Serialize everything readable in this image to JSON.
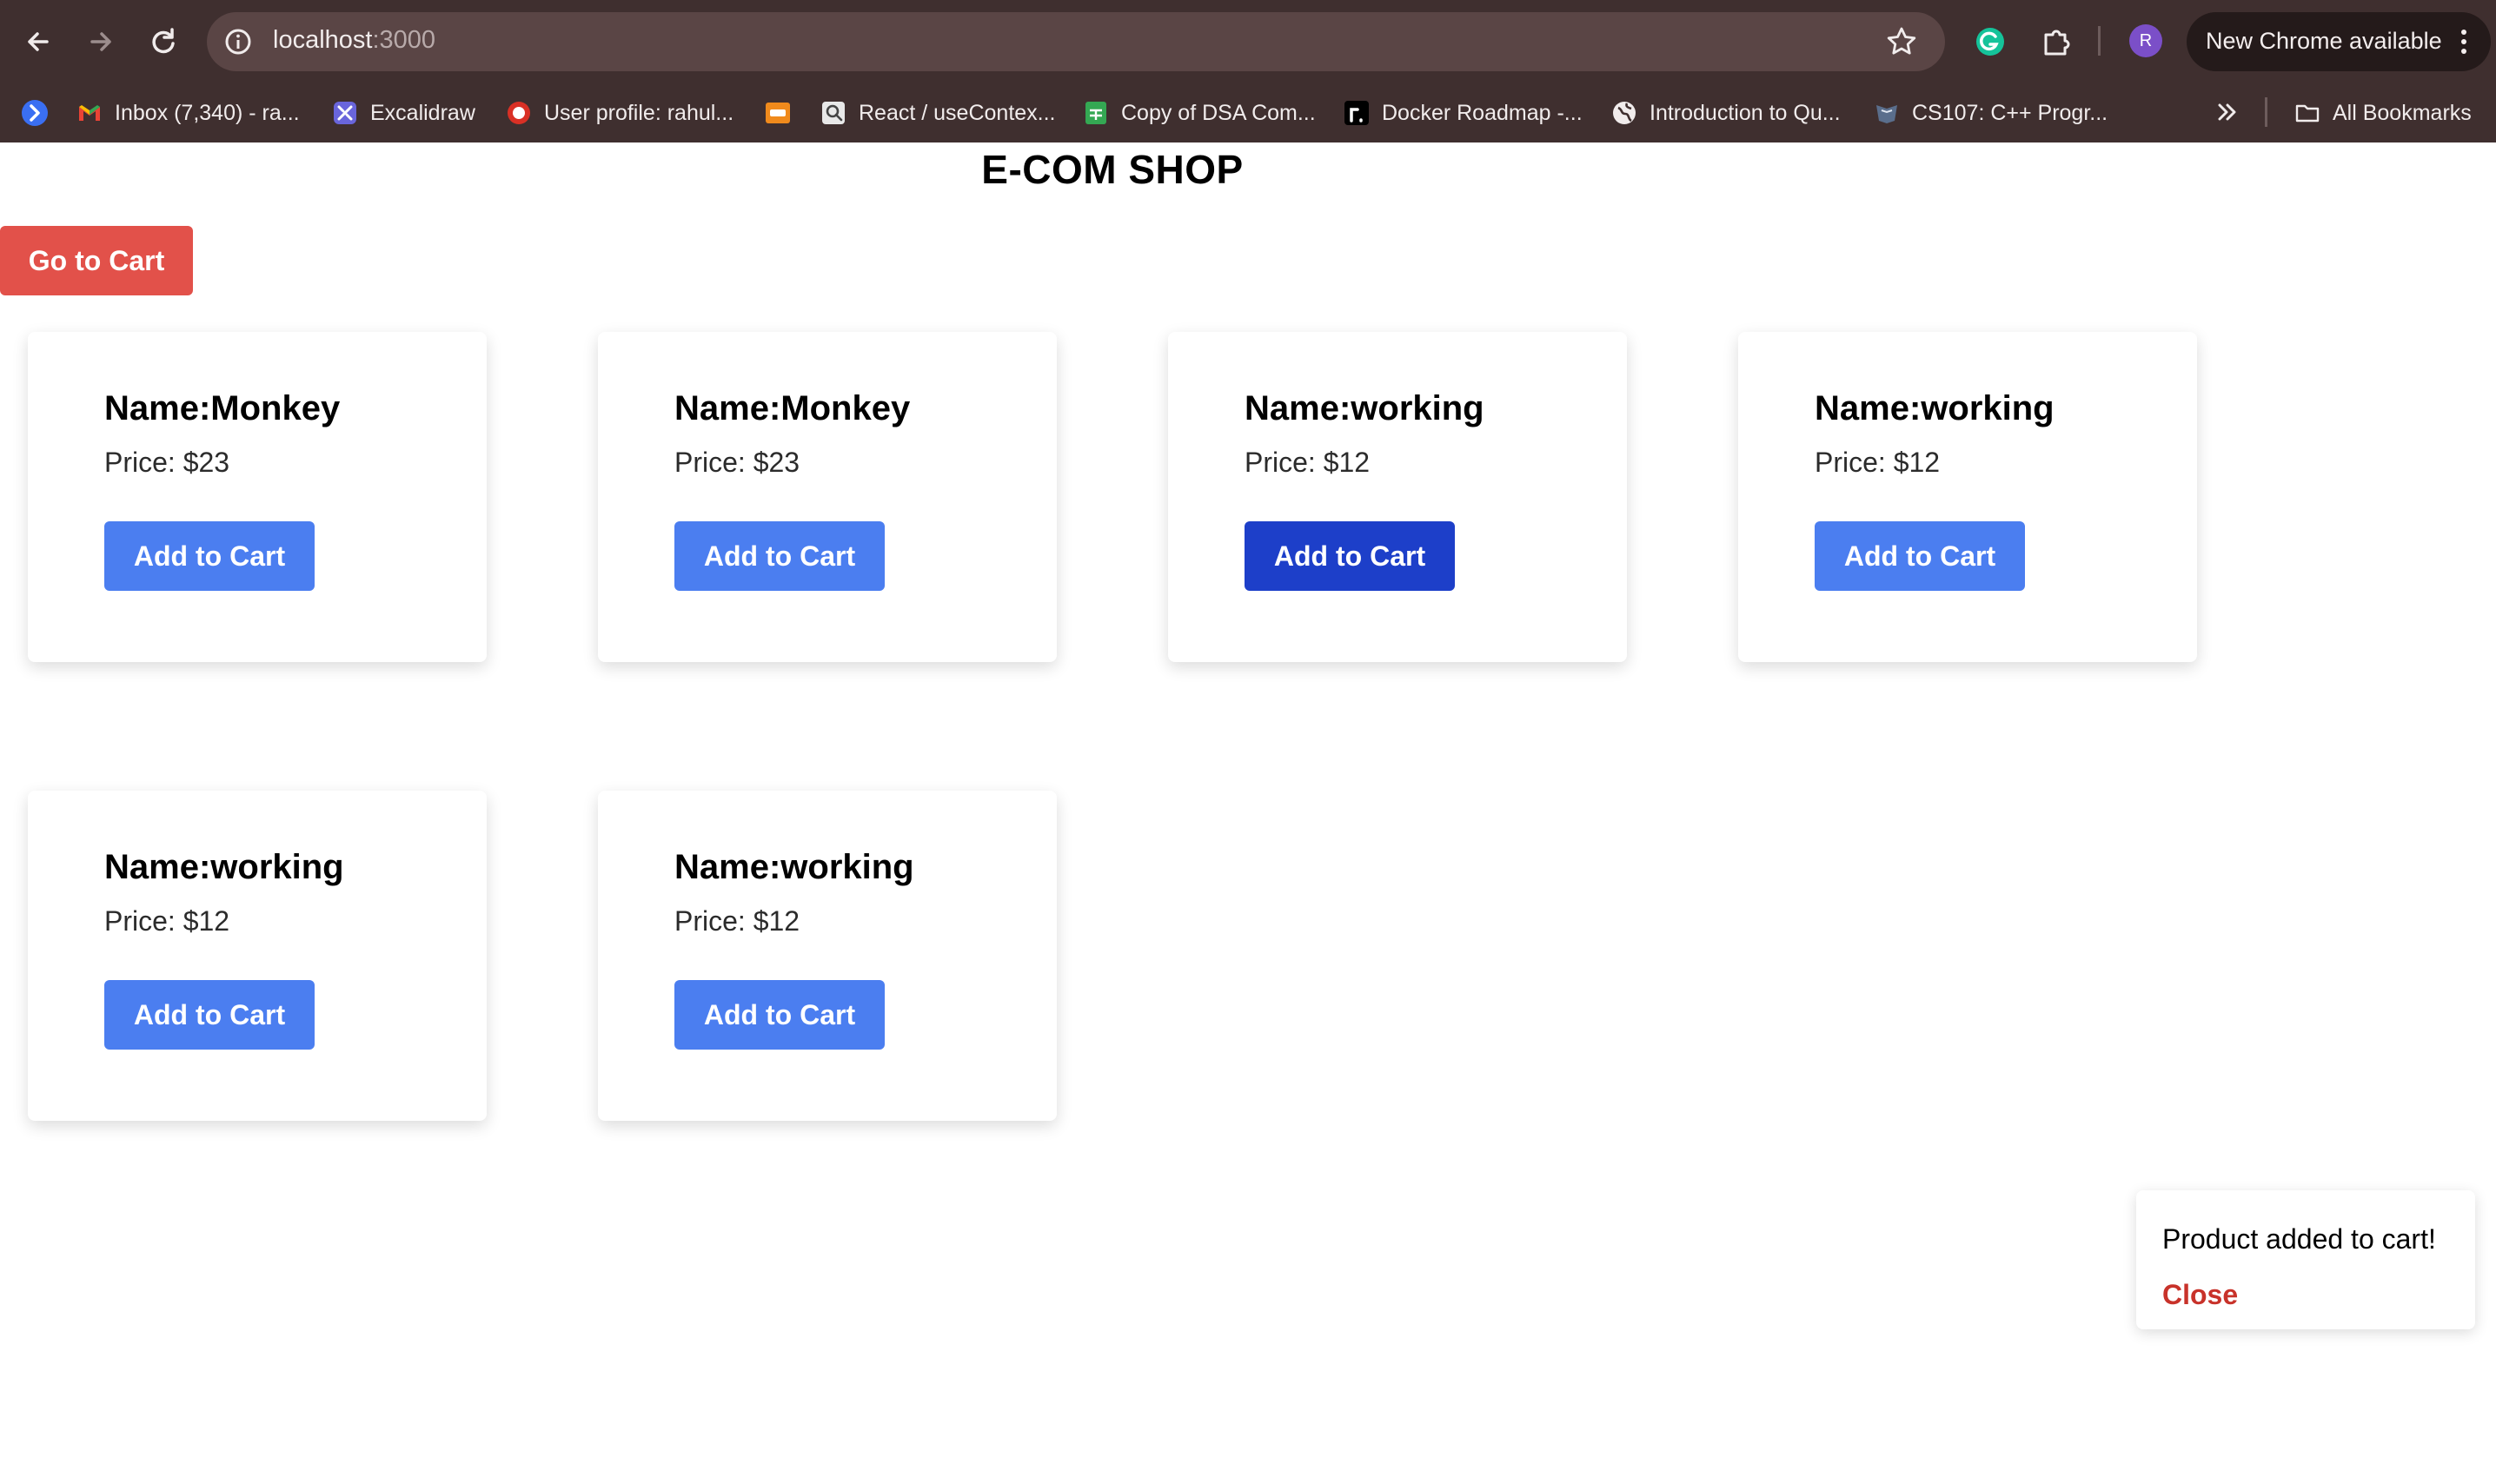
{
  "browser": {
    "url_host": "localhost",
    "url_port": ":3000",
    "update_label": "New Chrome available",
    "profile_initial": "R",
    "bookmarks": [
      {
        "label": "Inbox (7,340) - ra...",
        "icon": "gmail-icon"
      },
      {
        "label": "Excalidraw",
        "icon": "excalidraw-icon"
      },
      {
        "label": "User profile: rahul...",
        "icon": "user-profile-icon"
      },
      {
        "label": "",
        "icon": "orange-tile-icon"
      },
      {
        "label": "React / useContex...",
        "icon": "search-page-icon"
      },
      {
        "label": "Copy of DSA Com...",
        "icon": "sheets-icon"
      },
      {
        "label": "Docker Roadmap -...",
        "icon": "roadmap-icon"
      },
      {
        "label": "Introduction to Qu...",
        "icon": "globe-icon"
      },
      {
        "label": "CS107: C++ Progr...",
        "icon": "cs107-icon"
      }
    ],
    "all_bookmarks_label": "All Bookmarks"
  },
  "page": {
    "title": "E-COM SHOP",
    "cart_button_label": "Go to Cart",
    "products": [
      {
        "name": "Name:Monkey",
        "price": "Price: $23",
        "button": "Add to Cart"
      },
      {
        "name": "Name:Monkey",
        "price": "Price: $23",
        "button": "Add to Cart"
      },
      {
        "name": "Name:working",
        "price": "Price: $12",
        "button": "Add to Cart"
      },
      {
        "name": "Name:working",
        "price": "Price: $12",
        "button": "Add to Cart"
      },
      {
        "name": "Name:working",
        "price": "Price: $12",
        "button": "Add to Cart"
      },
      {
        "name": "Name:working",
        "price": "Price: $12",
        "button": "Add to Cart"
      }
    ],
    "toast": {
      "message": "Product added to cart!",
      "close_label": "Close"
    }
  },
  "colors": {
    "browser_frame": "#3f2f2f",
    "cart_button": "#e2514a",
    "add_button": "#4b7ef0",
    "add_button_active": "#1d3fc9",
    "toast_close": "#c8322a"
  }
}
